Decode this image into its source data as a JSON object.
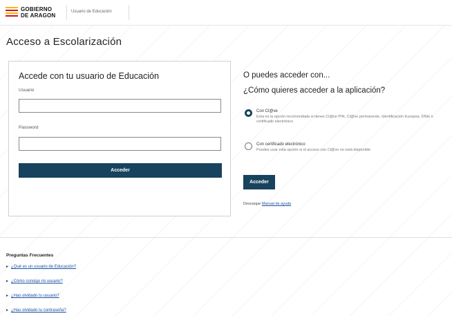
{
  "header": {
    "logo_line1": "GOBIERNO",
    "logo_line2": "DE ARAGON",
    "subtitle": "Usuario de Educación"
  },
  "page_title": "Acceso a Escolarización",
  "login": {
    "heading": "Accede con tu usuario de Educación",
    "username_label": "Usuario",
    "username_value": "",
    "password_label": "Password",
    "password_value": "",
    "submit_label": "Acceder"
  },
  "alternative": {
    "title": "O puedes acceder con...",
    "question": "¿Cómo quieres acceder a la aplicación?",
    "options": [
      {
        "label": "Con Cl@ve",
        "description": "Esta es la opción recomendada si tienes Cl@ve PIN, Cl@ve permanente, Identificación Europea, DNIe o certificado electrónico",
        "selected": true
      },
      {
        "label": "Con certificado electrónico",
        "description": "Puedes usar esta opción si el acceso con Cl@ve no está disponible",
        "selected": false
      }
    ],
    "submit_label": "Acceder",
    "help_prefix": "Descargar",
    "help_link": "Manual de ayuda"
  },
  "faq": {
    "title": "Preguntas Frecuentes",
    "items": [
      "¿Qué es un usuario de Educación?",
      "¿Cómo consigo mi usuario?",
      "¿Has olvidado tu usuario?",
      "¿Has olvidado tu contraseña?"
    ]
  },
  "colors": {
    "primary": "#17435e",
    "link": "#1a4fa0",
    "flag_yellow": "#f5b800",
    "flag_red": "#d0101a"
  }
}
